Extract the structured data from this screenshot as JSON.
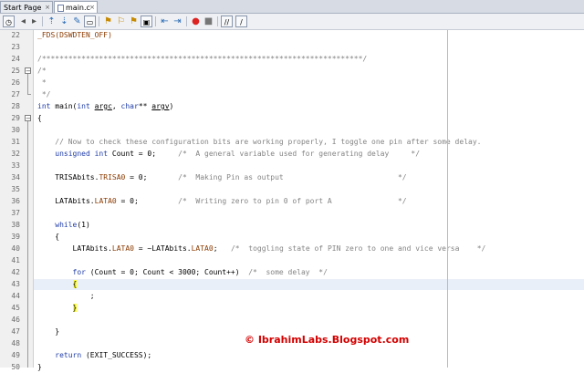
{
  "tabs": [
    {
      "label": "Start Page",
      "active": false
    },
    {
      "label": "main.c",
      "active": true
    }
  ],
  "tab_close_glyph": "×",
  "toolbar": {
    "icons": [
      "history-icon",
      "back-icon",
      "forward-icon",
      "find-prev-icon",
      "find-next-icon",
      "toggle-highlight-icon",
      "prev-bookmark-icon",
      "next-bookmark-icon",
      "toggle-bookmark-icon",
      "shift-left-icon",
      "shift-right-icon",
      "stop-macro-icon",
      "record-macro-icon",
      "comment-icon",
      "uncomment-icon"
    ]
  },
  "editor": {
    "line_numbers": [
      "22",
      "23",
      "24",
      "25",
      "26",
      "27",
      "28",
      "29",
      "30",
      "31",
      "32",
      "33",
      "34",
      "35",
      "36",
      "37",
      "38",
      "39",
      "40",
      "41",
      "42",
      "43",
      "44",
      "45",
      "46",
      "47",
      "48",
      "49",
      "50"
    ],
    "code": {
      "l22": "_FDS(DSWDTEN_OFF)",
      "l24": "/*************************************************************************/",
      "l25": "/*",
      "l26": " *",
      "l27": " */",
      "l28_type": "int",
      "l28_name": " main(",
      "l28_type2": "int",
      "l28_argc": "argc",
      "l28_sep": ", ",
      "l28_type3": "char",
      "l28_stars": "** ",
      "l28_argv": "argv",
      "l28_close": ")",
      "l29": "{",
      "l31": "    // Now to check these configuration bits are working properly, I toggle one pin after some delay.",
      "l32_kw": "    unsigned int",
      "l32_rest": " Count = 0;",
      "l32_cmt": "     /*  A general variable used for generating delay     */",
      "l34_a": "    TRISAbits.",
      "l34_b": "TRISA0",
      "l34_c": " = 0;",
      "l34_cmt": "       /*  Making Pin as output                          */",
      "l36_a": "    LATAbits.",
      "l36_b": "LATA0",
      "l36_c": " = 0;",
      "l36_cmt": "         /*  Writing zero to pin 0 of port A               */",
      "l38_kw": "    while",
      "l38_rest": "(1)",
      "l39": "    {",
      "l40_a": "        LATAbits.",
      "l40_b": "LATA0",
      "l40_c": " = ~LATAbits.",
      "l40_d": "LATA0",
      "l40_e": ";",
      "l40_cmt": "   /*  toggling state of PIN zero to one and vice versa    */",
      "l42_kw": "        for",
      "l42_rest": " (Count = 0; Count < 3000; Count++)",
      "l42_cmt": "  /*  some delay  */",
      "l43_brace": "{",
      "l44": "            ;",
      "l45_brace": "}",
      "l47": "    }",
      "l49_kw": "    return",
      "l49_rest": " (EXIT_SUCCESS);",
      "l50": "}"
    }
  },
  "watermark": "© IbrahimLabs.Blogspot.com",
  "colors": {
    "keyword": "#1f3ca8",
    "comment": "#848484",
    "macro": "#8a3a00",
    "brace_highlight": "#ffff33",
    "watermark": "#d40000"
  }
}
